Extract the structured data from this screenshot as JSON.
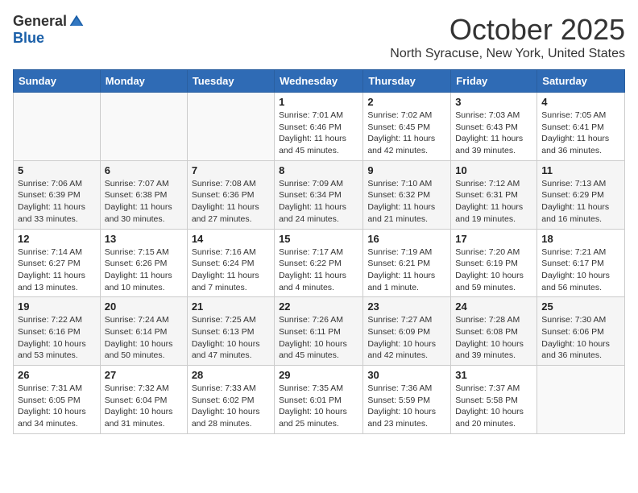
{
  "header": {
    "logo_general": "General",
    "logo_blue": "Blue",
    "month_title": "October 2025",
    "location": "North Syracuse, New York, United States"
  },
  "weekdays": [
    "Sunday",
    "Monday",
    "Tuesday",
    "Wednesday",
    "Thursday",
    "Friday",
    "Saturday"
  ],
  "weeks": [
    [
      {
        "day": "",
        "info": ""
      },
      {
        "day": "",
        "info": ""
      },
      {
        "day": "",
        "info": ""
      },
      {
        "day": "1",
        "info": "Sunrise: 7:01 AM\nSunset: 6:46 PM\nDaylight: 11 hours and 45 minutes."
      },
      {
        "day": "2",
        "info": "Sunrise: 7:02 AM\nSunset: 6:45 PM\nDaylight: 11 hours and 42 minutes."
      },
      {
        "day": "3",
        "info": "Sunrise: 7:03 AM\nSunset: 6:43 PM\nDaylight: 11 hours and 39 minutes."
      },
      {
        "day": "4",
        "info": "Sunrise: 7:05 AM\nSunset: 6:41 PM\nDaylight: 11 hours and 36 minutes."
      }
    ],
    [
      {
        "day": "5",
        "info": "Sunrise: 7:06 AM\nSunset: 6:39 PM\nDaylight: 11 hours and 33 minutes."
      },
      {
        "day": "6",
        "info": "Sunrise: 7:07 AM\nSunset: 6:38 PM\nDaylight: 11 hours and 30 minutes."
      },
      {
        "day": "7",
        "info": "Sunrise: 7:08 AM\nSunset: 6:36 PM\nDaylight: 11 hours and 27 minutes."
      },
      {
        "day": "8",
        "info": "Sunrise: 7:09 AM\nSunset: 6:34 PM\nDaylight: 11 hours and 24 minutes."
      },
      {
        "day": "9",
        "info": "Sunrise: 7:10 AM\nSunset: 6:32 PM\nDaylight: 11 hours and 21 minutes."
      },
      {
        "day": "10",
        "info": "Sunrise: 7:12 AM\nSunset: 6:31 PM\nDaylight: 11 hours and 19 minutes."
      },
      {
        "day": "11",
        "info": "Sunrise: 7:13 AM\nSunset: 6:29 PM\nDaylight: 11 hours and 16 minutes."
      }
    ],
    [
      {
        "day": "12",
        "info": "Sunrise: 7:14 AM\nSunset: 6:27 PM\nDaylight: 11 hours and 13 minutes."
      },
      {
        "day": "13",
        "info": "Sunrise: 7:15 AM\nSunset: 6:26 PM\nDaylight: 11 hours and 10 minutes."
      },
      {
        "day": "14",
        "info": "Sunrise: 7:16 AM\nSunset: 6:24 PM\nDaylight: 11 hours and 7 minutes."
      },
      {
        "day": "15",
        "info": "Sunrise: 7:17 AM\nSunset: 6:22 PM\nDaylight: 11 hours and 4 minutes."
      },
      {
        "day": "16",
        "info": "Sunrise: 7:19 AM\nSunset: 6:21 PM\nDaylight: 11 hours and 1 minute."
      },
      {
        "day": "17",
        "info": "Sunrise: 7:20 AM\nSunset: 6:19 PM\nDaylight: 10 hours and 59 minutes."
      },
      {
        "day": "18",
        "info": "Sunrise: 7:21 AM\nSunset: 6:17 PM\nDaylight: 10 hours and 56 minutes."
      }
    ],
    [
      {
        "day": "19",
        "info": "Sunrise: 7:22 AM\nSunset: 6:16 PM\nDaylight: 10 hours and 53 minutes."
      },
      {
        "day": "20",
        "info": "Sunrise: 7:24 AM\nSunset: 6:14 PM\nDaylight: 10 hours and 50 minutes."
      },
      {
        "day": "21",
        "info": "Sunrise: 7:25 AM\nSunset: 6:13 PM\nDaylight: 10 hours and 47 minutes."
      },
      {
        "day": "22",
        "info": "Sunrise: 7:26 AM\nSunset: 6:11 PM\nDaylight: 10 hours and 45 minutes."
      },
      {
        "day": "23",
        "info": "Sunrise: 7:27 AM\nSunset: 6:09 PM\nDaylight: 10 hours and 42 minutes."
      },
      {
        "day": "24",
        "info": "Sunrise: 7:28 AM\nSunset: 6:08 PM\nDaylight: 10 hours and 39 minutes."
      },
      {
        "day": "25",
        "info": "Sunrise: 7:30 AM\nSunset: 6:06 PM\nDaylight: 10 hours and 36 minutes."
      }
    ],
    [
      {
        "day": "26",
        "info": "Sunrise: 7:31 AM\nSunset: 6:05 PM\nDaylight: 10 hours and 34 minutes."
      },
      {
        "day": "27",
        "info": "Sunrise: 7:32 AM\nSunset: 6:04 PM\nDaylight: 10 hours and 31 minutes."
      },
      {
        "day": "28",
        "info": "Sunrise: 7:33 AM\nSunset: 6:02 PM\nDaylight: 10 hours and 28 minutes."
      },
      {
        "day": "29",
        "info": "Sunrise: 7:35 AM\nSunset: 6:01 PM\nDaylight: 10 hours and 25 minutes."
      },
      {
        "day": "30",
        "info": "Sunrise: 7:36 AM\nSunset: 5:59 PM\nDaylight: 10 hours and 23 minutes."
      },
      {
        "day": "31",
        "info": "Sunrise: 7:37 AM\nSunset: 5:58 PM\nDaylight: 10 hours and 20 minutes."
      },
      {
        "day": "",
        "info": ""
      }
    ]
  ]
}
